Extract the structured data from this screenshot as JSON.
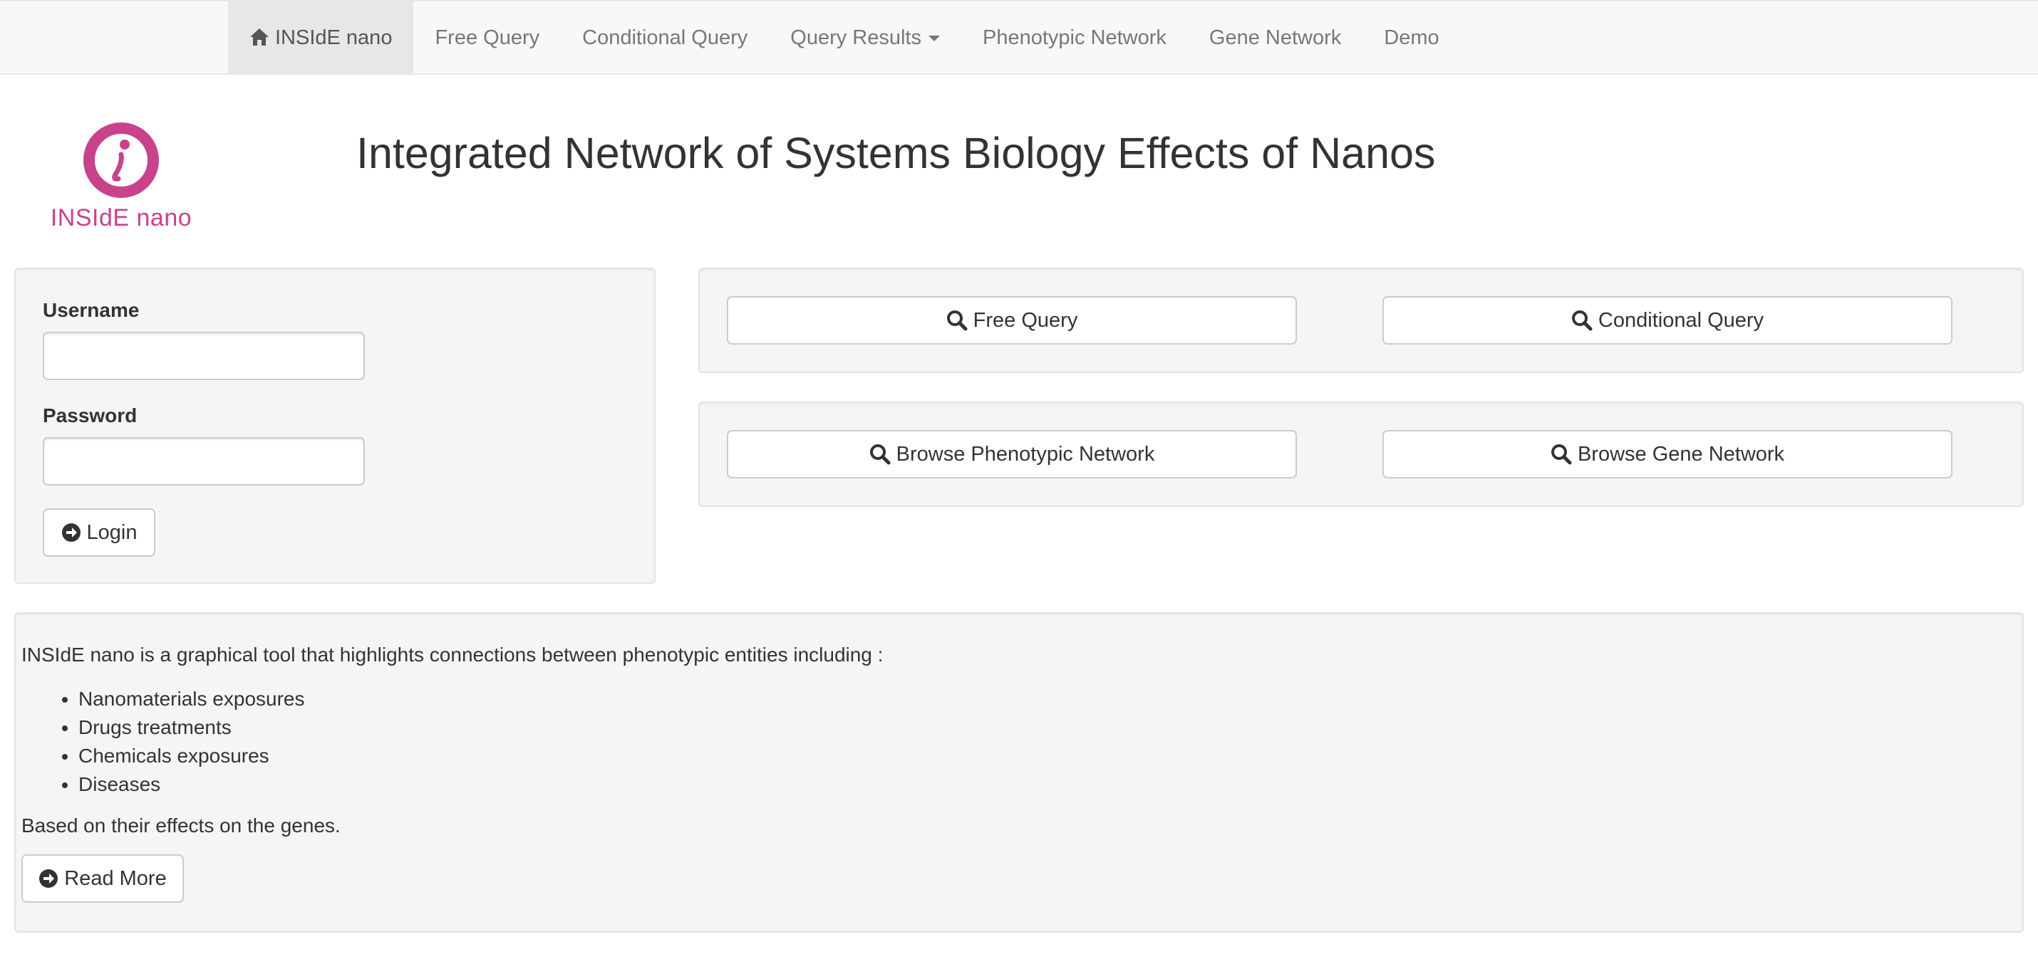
{
  "nav": {
    "brand": "INSIdE nano",
    "items": [
      "Free Query",
      "Conditional Query",
      "Query Results",
      "Phenotypic Network",
      "Gene Network",
      "Demo"
    ]
  },
  "logo": {
    "text": "INSIdE nano",
    "color": "#c8428c"
  },
  "header": {
    "title": "Integrated Network of Systems Biology Effects of Nanos"
  },
  "login": {
    "username_label": "Username",
    "username_value": "",
    "password_label": "Password",
    "password_value": "",
    "login_button": "Login"
  },
  "actions": {
    "free_query": "Free Query",
    "conditional_query": "Conditional Query",
    "browse_phenotypic": "Browse Phenotypic Network",
    "browse_gene": "Browse Gene Network"
  },
  "info": {
    "intro": "INSIdE nano is a graphical tool that highlights connections between phenotypic entities including :",
    "items": [
      "Nanomaterials exposures",
      "Drugs treatments",
      "Chemicals exposures",
      "Diseases"
    ],
    "outro": "Based on their effects on the genes.",
    "read_more": "Read More"
  },
  "icons": {
    "home": "home-icon",
    "search": "search-icon",
    "arrow": "arrow-circle-right-icon",
    "caret": "caret-down-icon"
  }
}
